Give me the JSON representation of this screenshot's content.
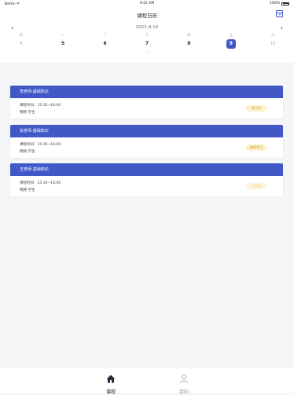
{
  "status": {
    "carrier": "Bettin ᯤ",
    "time": "9:41 AM",
    "battery": "100%"
  },
  "nav": {
    "title": "课程日历"
  },
  "calendar": {
    "month": "2021-4-14",
    "prev_arrow": "‹",
    "next_arrow": "›",
    "weekdays": [
      "日",
      "一",
      "二",
      "三",
      "四",
      "五",
      "六"
    ],
    "dates": [
      "4",
      "5",
      "6",
      "7",
      "8",
      "9",
      "10"
    ],
    "selected_index": 5,
    "collapse_icon": "⌃"
  },
  "courses": [
    {
      "title": "李老师-基础知识",
      "time": "课程时间：15:30~16:00",
      "class": "网络-学生",
      "status": "学习中"
    },
    {
      "title": "张老师-基础知识",
      "time": "课程时间：15:30~16:00",
      "class": "网络-学生",
      "status": "继续学习"
    },
    {
      "title": "王老师-基础知识",
      "time": "课程时间：15:30~16:00",
      "class": "网络-学生",
      "status": "已完成"
    }
  ],
  "tabs": [
    {
      "label": "课程",
      "icon": "home-icon"
    },
    {
      "label": "我的",
      "icon": "user-icon"
    }
  ],
  "colors": {
    "accent": "#4159c7",
    "badge_bg": "#fdf0c8",
    "badge_text": "#c09220"
  }
}
